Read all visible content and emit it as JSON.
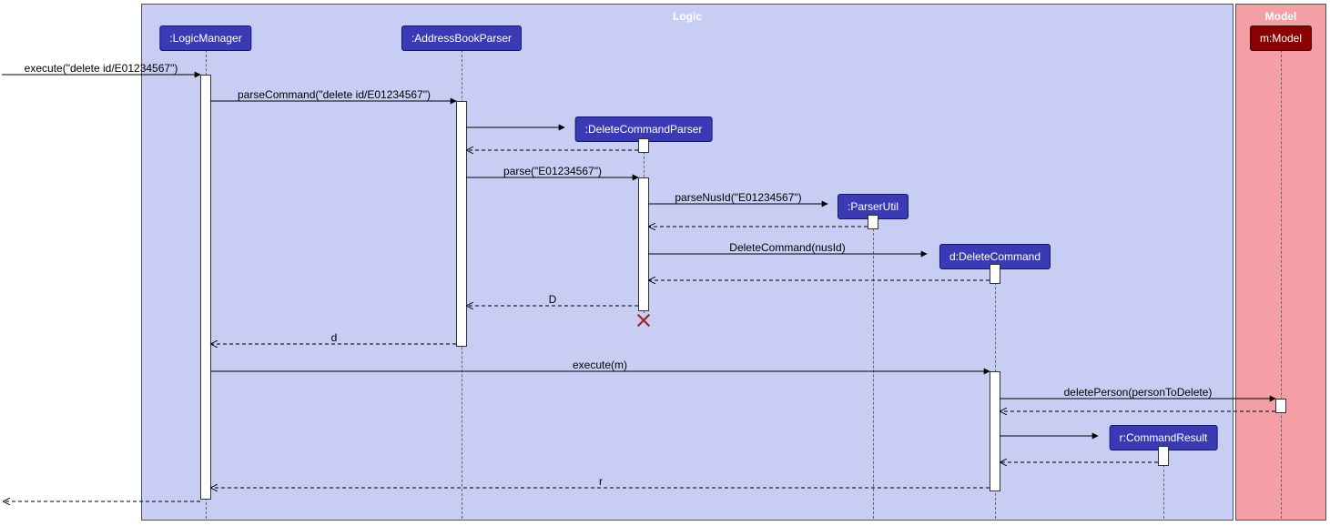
{
  "groups": {
    "logic": "Logic",
    "model": "Model"
  },
  "participants": {
    "logicManager": ":LogicManager",
    "addressBookParser": ":AddressBookParser",
    "deleteCommandParser": ":DeleteCommandParser",
    "parserUtil": ":ParserUtil",
    "deleteCommand": "d:DeleteCommand",
    "commandResult": "r:CommandResult",
    "model": "m:Model"
  },
  "messages": {
    "m1": "execute(\"delete id/E01234567\")",
    "m2": "parseCommand(\"delete id/E01234567\")",
    "m3": "parse(\"E01234567\")",
    "m4": "parseNusId(\"E01234567\")",
    "m5": "DeleteCommand(nusId)",
    "m6": "D",
    "m7": "d",
    "m8": "execute(m)",
    "m9": "deletePerson(personToDelete)",
    "m10": "r"
  },
  "chart_data": {
    "type": "sequence-diagram",
    "groups": [
      {
        "name": "Logic",
        "participants": [
          "LogicManager",
          "AddressBookParser",
          "DeleteCommandParser",
          "ParserUtil",
          "DeleteCommand",
          "CommandResult"
        ]
      },
      {
        "name": "Model",
        "participants": [
          "Model"
        ]
      }
    ],
    "participants": [
      {
        "id": "LogicManager",
        "label": ":LogicManager"
      },
      {
        "id": "AddressBookParser",
        "label": ":AddressBookParser"
      },
      {
        "id": "DeleteCommandParser",
        "label": ":DeleteCommandParser",
        "created_by_msg": 2
      },
      {
        "id": "ParserUtil",
        "label": ":ParserUtil"
      },
      {
        "id": "DeleteCommand",
        "label": "d:DeleteCommand",
        "created_by_msg": 5
      },
      {
        "id": "CommandResult",
        "label": "r:CommandResult",
        "created_by_msg": 10
      },
      {
        "id": "Model",
        "label": "m:Model"
      }
    ],
    "messages": [
      {
        "n": 1,
        "from": "caller",
        "to": "LogicManager",
        "label": "execute(\"delete id/E01234567\")",
        "type": "sync"
      },
      {
        "n": 2,
        "from": "LogicManager",
        "to": "AddressBookParser",
        "label": "parseCommand(\"delete id/E01234567\")",
        "type": "sync"
      },
      {
        "n": 3,
        "from": "AddressBookParser",
        "to": "DeleteCommandParser",
        "label": "<<create>>",
        "type": "sync"
      },
      {
        "n": 3.1,
        "from": "DeleteCommandParser",
        "to": "AddressBookParser",
        "label": "",
        "type": "return"
      },
      {
        "n": 4,
        "from": "AddressBookParser",
        "to": "DeleteCommandParser",
        "label": "parse(\"E01234567\")",
        "type": "sync"
      },
      {
        "n": 5,
        "from": "DeleteCommandParser",
        "to": "ParserUtil",
        "label": "parseNusId(\"E01234567\")",
        "type": "sync"
      },
      {
        "n": 5.1,
        "from": "ParserUtil",
        "to": "DeleteCommandParser",
        "label": "",
        "type": "return"
      },
      {
        "n": 6,
        "from": "DeleteCommandParser",
        "to": "DeleteCommand",
        "label": "DeleteCommand(nusId)",
        "type": "sync"
      },
      {
        "n": 6.1,
        "from": "DeleteCommand",
        "to": "DeleteCommandParser",
        "label": "",
        "type": "return"
      },
      {
        "n": 7,
        "from": "DeleteCommandParser",
        "to": "AddressBookParser",
        "label": "D",
        "type": "return"
      },
      {
        "n": 7.1,
        "event": "destroy",
        "target": "DeleteCommandParser"
      },
      {
        "n": 8,
        "from": "AddressBookParser",
        "to": "LogicManager",
        "label": "d",
        "type": "return"
      },
      {
        "n": 9,
        "from": "LogicManager",
        "to": "DeleteCommand",
        "label": "execute(m)",
        "type": "sync"
      },
      {
        "n": 10,
        "from": "DeleteCommand",
        "to": "Model",
        "label": "deletePerson(personToDelete)",
        "type": "sync"
      },
      {
        "n": 10.1,
        "from": "Model",
        "to": "DeleteCommand",
        "label": "",
        "type": "return"
      },
      {
        "n": 11,
        "from": "DeleteCommand",
        "to": "CommandResult",
        "label": "<<create>>",
        "type": "sync"
      },
      {
        "n": 11.1,
        "from": "CommandResult",
        "to": "DeleteCommand",
        "label": "",
        "type": "return"
      },
      {
        "n": 12,
        "from": "DeleteCommand",
        "to": "LogicManager",
        "label": "r",
        "type": "return"
      },
      {
        "n": 13,
        "from": "LogicManager",
        "to": "caller",
        "label": "",
        "type": "return"
      }
    ]
  }
}
